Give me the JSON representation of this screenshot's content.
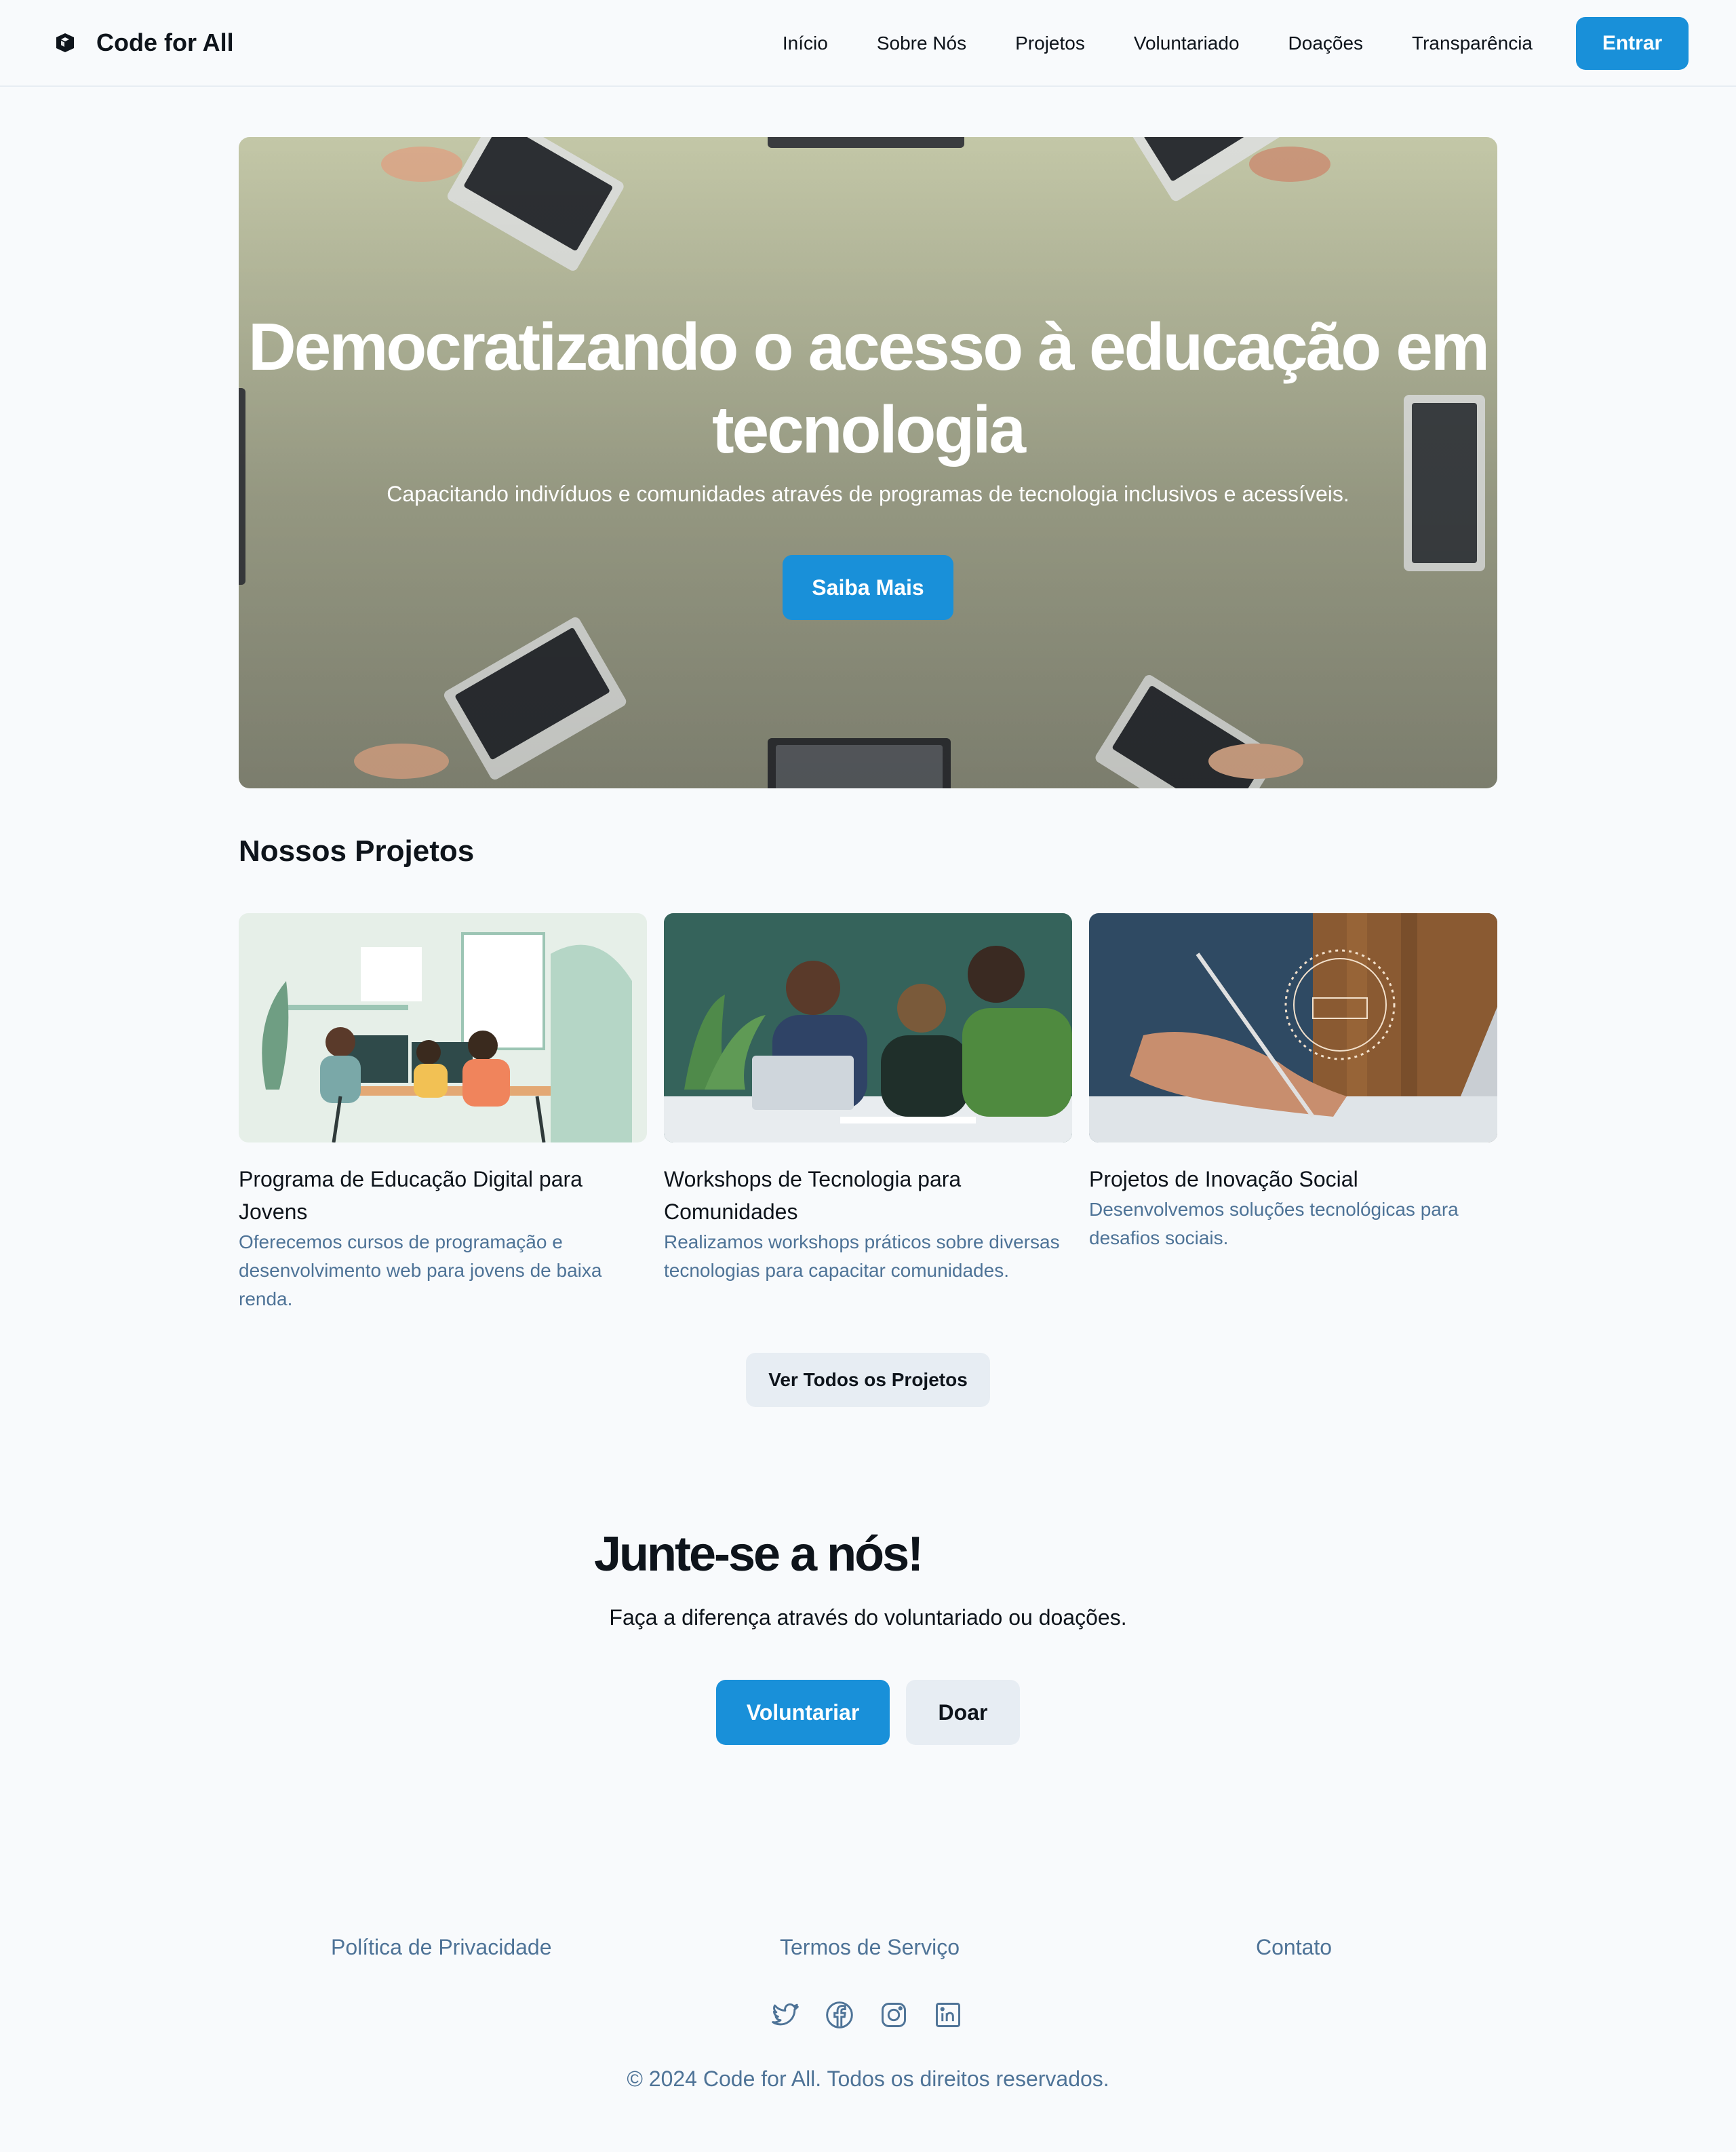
{
  "header": {
    "brand": "Code for All",
    "nav": [
      "Início",
      "Sobre Nós",
      "Projetos",
      "Voluntariado",
      "Doações",
      "Transparência"
    ],
    "login_label": "Entrar"
  },
  "hero": {
    "title": "Democratizando o acesso à educação em tecnologia",
    "subtitle": "Capacitando indivíduos e comunidades através de programas de tecnologia inclusivos e acessíveis.",
    "cta_label": "Saiba Mais"
  },
  "projects": {
    "heading": "Nossos Projetos",
    "items": [
      {
        "title": "Programa de Educação Digital para Jovens",
        "description": "Oferecemos cursos de programação e desenvolvimento web para jovens de baixa renda."
      },
      {
        "title": "Workshops de Tecnologia para Comunidades",
        "description": "Realizamos workshops práticos sobre diversas tecnologias para capacitar comunidades."
      },
      {
        "title": "Projetos de Inovação Social",
        "description": "Desenvolvemos soluções tecnológicas para desafios sociais."
      }
    ],
    "view_all_label": "Ver Todos os Projetos"
  },
  "cta": {
    "title": "Junte-se a nós!",
    "subtitle": "Faça a diferença através do voluntariado ou doações.",
    "volunteer_label": "Voluntariar",
    "donate_label": "Doar"
  },
  "footer": {
    "links": [
      "Política de Privacidade",
      "Termos de Serviço",
      "Contato"
    ],
    "social_icons": [
      "twitter-icon",
      "facebook-icon",
      "instagram-icon",
      "linkedin-icon"
    ],
    "copyright": "© 2024 Code for All. Todos os direitos reservados."
  },
  "colors": {
    "accent": "#1990d9",
    "secondary_bg": "#e7edf3",
    "muted_text": "#4e7397",
    "page_bg": "#f8fafc"
  }
}
